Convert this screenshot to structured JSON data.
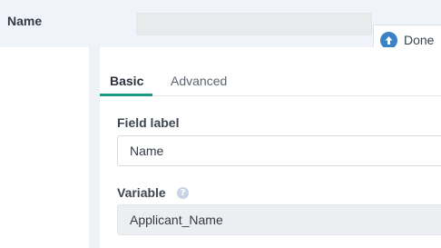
{
  "header": {
    "field_name": "Name",
    "done_label": "Done"
  },
  "tabs": [
    {
      "label": "Basic",
      "active": true
    },
    {
      "label": "Advanced",
      "active": false
    }
  ],
  "form": {
    "field_label": {
      "label": "Field label",
      "value": "Name"
    },
    "variable": {
      "label": "Variable",
      "value": "Applicant_Name",
      "help_icon": "question-circle-icon"
    }
  },
  "colors": {
    "accent": "#1b9a84",
    "done_icon": "#3b82c4",
    "header_bg": "#f0f4fa"
  }
}
